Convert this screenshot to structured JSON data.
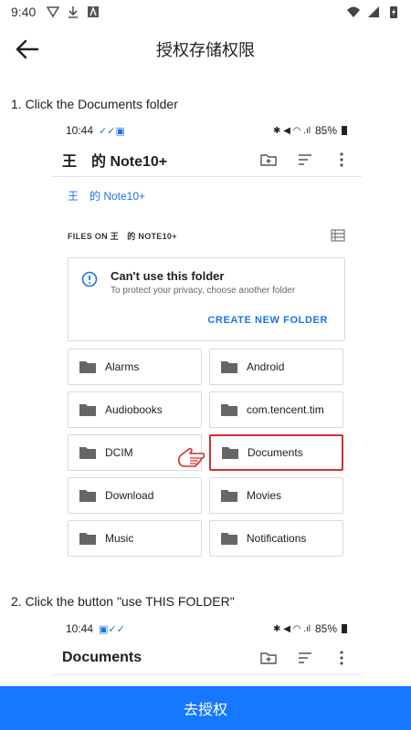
{
  "status_bar": {
    "time": "9:40"
  },
  "header": {
    "title": "授权存储权限"
  },
  "step1": {
    "label": "1. Click the Documents folder",
    "mock": {
      "time": "10:44",
      "battery": "85%",
      "toolbar_title": "王　的 Note10+",
      "breadcrumb": "王　的 Note10+",
      "files_on": "FILES ON 王　的 NOTE10+",
      "warning": {
        "title": "Can't use this folder",
        "subtitle": "To protect your privacy, choose another folder",
        "action": "CREATE NEW FOLDER"
      },
      "folders": [
        {
          "name": "Alarms"
        },
        {
          "name": "Android"
        },
        {
          "name": "Audiobooks"
        },
        {
          "name": "com.tencent.tim"
        },
        {
          "name": "DCIM"
        },
        {
          "name": "Documents"
        },
        {
          "name": "Download"
        },
        {
          "name": "Movies"
        },
        {
          "name": "Music"
        },
        {
          "name": "Notifications"
        }
      ],
      "highlighted_folder": "Documents"
    }
  },
  "step2": {
    "label": "2. Click the button \"use THIS FOLDER\"",
    "mock": {
      "time": "10:44",
      "battery": "85%",
      "toolbar_title": "Documents"
    }
  },
  "primary_button": {
    "label": "去授权"
  },
  "colors": {
    "accent": "#1677ff",
    "link": "#1a73e8",
    "highlight": "#d32f2f"
  }
}
